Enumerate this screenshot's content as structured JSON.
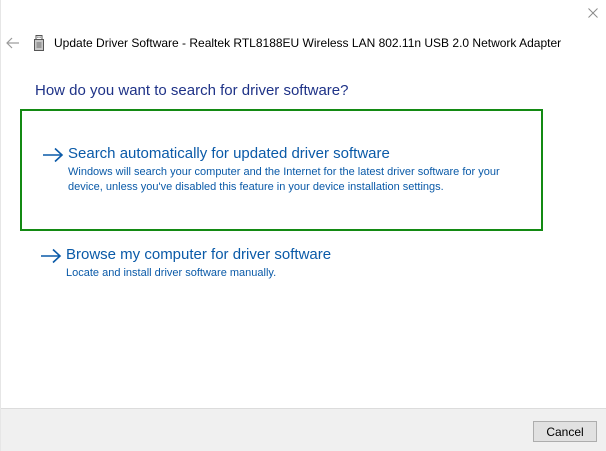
{
  "window": {
    "close_icon": "close-icon",
    "back_icon": "back-arrow-icon"
  },
  "header": {
    "device_icon": "usb-device-icon",
    "title": "Update Driver Software - Realtek RTL8188EU Wireless LAN 802.11n USB 2.0 Network Adapter"
  },
  "main": {
    "instruction": "How do you want to search for driver software?",
    "options": [
      {
        "title": "Search automatically for updated driver software",
        "description": "Windows will search your computer and the Internet for the latest driver software for your device, unless you've disabled this feature in your device installation settings.",
        "icon": "arrow-right-icon",
        "highlighted": true
      },
      {
        "title": "Browse my computer for driver software",
        "description": "Locate and install driver software manually.",
        "icon": "arrow-right-icon",
        "highlighted": false
      }
    ]
  },
  "footer": {
    "cancel_label": "Cancel"
  },
  "colors": {
    "instruction": "#1e3287",
    "link": "#0a5aa8",
    "highlight_border": "#138a13",
    "footer_bg": "#f0f0f0"
  }
}
